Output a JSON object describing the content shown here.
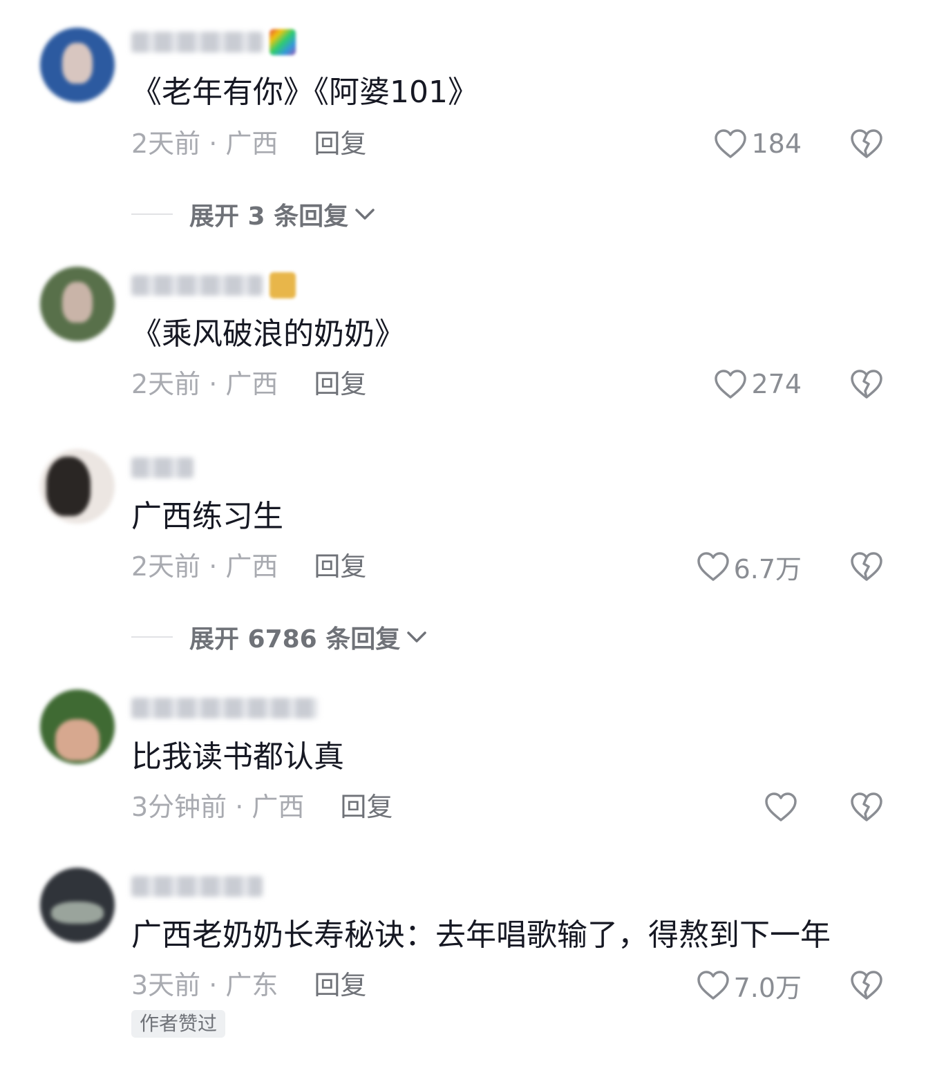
{
  "comments": [
    {
      "text": "《老年有你》《阿婆101》",
      "time": "2天前 · 广西",
      "reply": "回复",
      "likes": "184",
      "expand": "展开 3 条回复",
      "avatar_colors": [
        "#2c5aa0",
        "#d8c6c0"
      ],
      "badge": "rainbow-badge"
    },
    {
      "text": "《乘风破浪的奶奶》",
      "time": "2天前 · 广西",
      "reply": "回复",
      "likes": "274",
      "avatar_colors": [
        "#58704a",
        "#c9b4a8"
      ],
      "badge": "gold-badge"
    },
    {
      "text": "广西练习生",
      "time": "2天前 · 广西",
      "reply": "回复",
      "likes": "6.7万",
      "expand": "展开 6786 条回复",
      "avatar_colors": [
        "#2a2624",
        "#e6d8d0"
      ]
    },
    {
      "text": "比我读书都认真",
      "time": "3分钟前 · 广西",
      "reply": "回复",
      "likes": "",
      "avatar_colors": [
        "#3f6a33",
        "#d7a88f"
      ]
    },
    {
      "text": "广西老奶奶长寿秘诀：去年唱歌输了，得熬到下一年",
      "time": "3天前 · 广东",
      "reply": "回复",
      "likes": "7.0万",
      "author_tag": "作者赞过",
      "avatar_colors": [
        "#30343a",
        "#9aa49c"
      ]
    }
  ],
  "icons": {
    "like": "heart-outline-icon",
    "dislike": "broken-heart-icon",
    "expand": "chevron-down-icon"
  }
}
